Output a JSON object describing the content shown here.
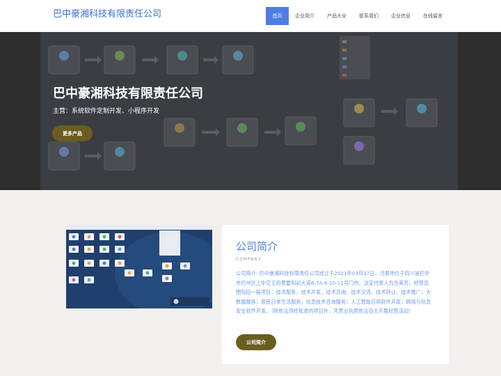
{
  "header": {
    "brand": "巴中豪湘科技有限责任公司",
    "nav": [
      {
        "label": "首页",
        "active": true
      },
      {
        "label": "企业简介",
        "active": false
      },
      {
        "label": "产品大全",
        "active": false
      },
      {
        "label": "联系我们",
        "active": false
      },
      {
        "label": "企业信息",
        "active": false
      },
      {
        "label": "在线留言",
        "active": false
      }
    ]
  },
  "hero": {
    "title": "巴中豪湘科技有限责任公司",
    "subtitle": "主营：系统软件定制开发、小程序开发",
    "button_label": "更多产品"
  },
  "about": {
    "title": "公司简介",
    "subtitle": "COMPANY",
    "text": "公司简介: 巴中豪湘科技有限责任公司成立于2021年03月17日，注册地位于四川省巴中市巴州区上中交王府景要阳初大道6-7A-6-10-11号门市，法定代表人为岳美芳。经营范围包括一般项目：技术服务、技术开发、技术咨询、技术交流、技术转让、技术推广；大数据服务；居民日常生活服务；信息技术咨询服务；人工智能应用软件开发；网络与信息安全软件开发。（除依法须经批准的项目外，凭营业执照依法自主开展经营活动）",
    "button_label": "公司简介"
  },
  "colors": {
    "accent": "#4f7de2",
    "button": "#6b5d22",
    "background": "#f2f0ed"
  }
}
